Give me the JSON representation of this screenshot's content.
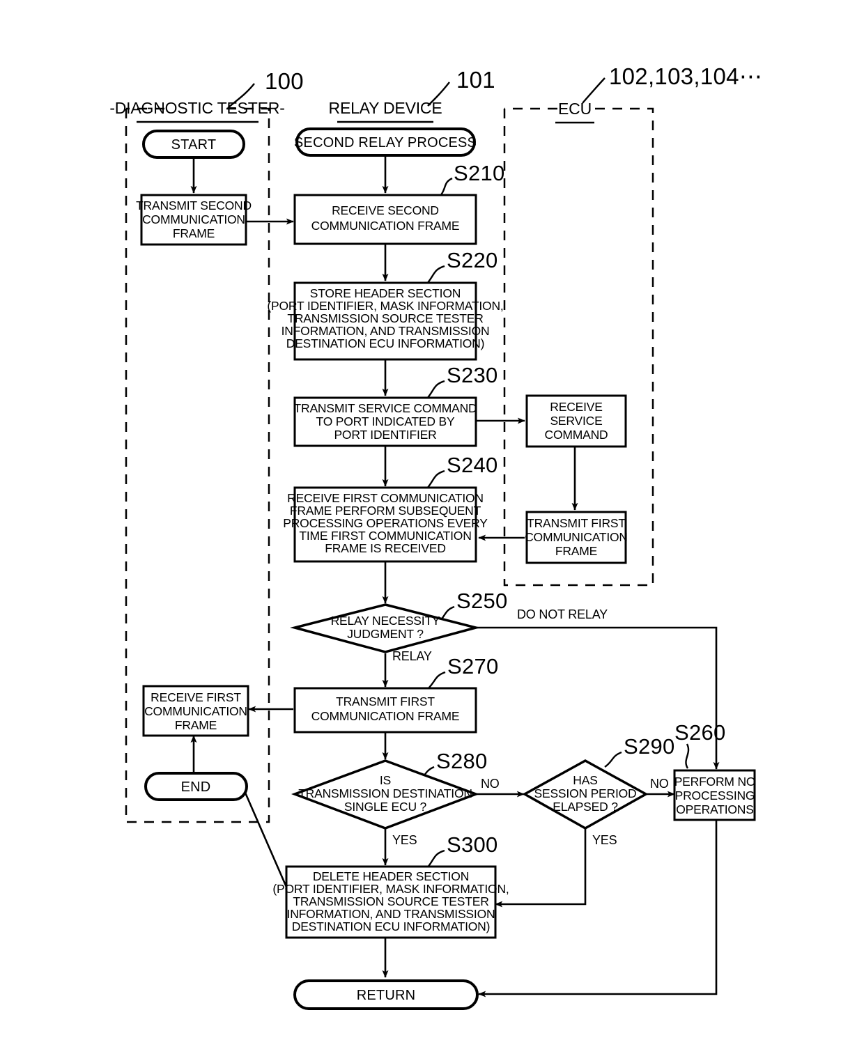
{
  "figure": {
    "type": "flowchart",
    "title": "Second relay process flowchart",
    "regions": [
      {
        "id": "tester",
        "label": "-DIAGNOSTIC TESTER-",
        "ref": "100",
        "style": "dashed"
      },
      {
        "id": "relay",
        "label": "RELAY DEVICE",
        "ref": "101",
        "style": "none"
      },
      {
        "id": "ecu",
        "label": "ECU",
        "ref": "102,103,104⋯",
        "style": "dashed"
      }
    ],
    "nodes": {
      "start": {
        "shape": "terminator",
        "text": "START",
        "region": "tester"
      },
      "transmit_second": {
        "shape": "process",
        "region": "tester",
        "lines": [
          "TRANSMIT SECOND",
          "COMMUNICATION",
          "FRAME"
        ]
      },
      "second_relay_process": {
        "shape": "terminator",
        "text": "SECOND RELAY PROCESS",
        "region": "relay"
      },
      "s210": {
        "shape": "process",
        "step": "S210",
        "region": "relay",
        "lines": [
          "RECEIVE SECOND",
          "COMMUNICATION FRAME"
        ]
      },
      "s220": {
        "shape": "process",
        "step": "S220",
        "region": "relay",
        "lines": [
          "STORE HEADER SECTION",
          "(PORT IDENTIFIER, MASK INFORMATION,",
          "TRANSMISSION SOURCE TESTER",
          "INFORMATION, AND TRANSMISSION",
          "DESTINATION ECU INFORMATION)"
        ]
      },
      "s230": {
        "shape": "process",
        "step": "S230",
        "region": "relay",
        "lines": [
          "TRANSMIT SERVICE COMMAND",
          "TO PORT INDICATED BY",
          "PORT IDENTIFIER"
        ]
      },
      "receive_service_command": {
        "shape": "process",
        "region": "ecu",
        "lines": [
          "RECEIVE",
          "SERVICE",
          "COMMAND"
        ]
      },
      "s240": {
        "shape": "process",
        "step": "S240",
        "region": "relay",
        "lines": [
          "RECEIVE FIRST COMMUNICATION",
          "FRAME PERFORM SUBSEQUENT",
          "PROCESSING OPERATIONS EVERY",
          "TIME FIRST COMMUNICATION",
          "FRAME IS RECEIVED"
        ]
      },
      "transmit_first_ecu": {
        "shape": "process",
        "region": "ecu",
        "lines": [
          "TRANSMIT FIRST",
          "COMMUNICATION",
          "FRAME"
        ]
      },
      "s250": {
        "shape": "decision",
        "step": "S250",
        "region": "relay",
        "lines": [
          "RELAY NECESSITY",
          "JUDGMENT ?"
        ],
        "branches": [
          "DO NOT RELAY",
          "RELAY"
        ]
      },
      "s270": {
        "shape": "process",
        "step": "S270",
        "region": "relay",
        "lines": [
          "TRANSMIT FIRST",
          "COMMUNICATION FRAME"
        ]
      },
      "receive_first_tester": {
        "shape": "process",
        "region": "tester",
        "lines": [
          "RECEIVE FIRST",
          "COMMUNICATION",
          "FRAME"
        ]
      },
      "end": {
        "shape": "terminator",
        "text": "END",
        "region": "tester"
      },
      "s280": {
        "shape": "decision",
        "step": "S280",
        "region": "relay",
        "lines": [
          "IS",
          "TRANSMISSION DESTINATION",
          "SINGLE ECU ?"
        ],
        "branches": [
          "NO",
          "YES"
        ]
      },
      "s290": {
        "shape": "decision",
        "step": "S290",
        "region": "relay",
        "lines": [
          "HAS",
          "SESSION PERIOD",
          "ELAPSED ?"
        ],
        "branches": [
          "NO",
          "YES"
        ]
      },
      "s260": {
        "shape": "process",
        "step": "S260",
        "region": "relay",
        "lines": [
          "PERFORM NO",
          "PROCESSING",
          "OPERATIONS"
        ]
      },
      "s300": {
        "shape": "process",
        "step": "S300",
        "region": "relay",
        "lines": [
          "DELETE HEADER SECTION",
          "(PORT IDENTIFIER, MASK INFORMATION,",
          "TRANSMISSION SOURCE TESTER",
          "INFORMATION, AND TRANSMISSION",
          "DESTINATION ECU INFORMATION)"
        ]
      },
      "return": {
        "shape": "terminator",
        "text": "RETURN",
        "region": "relay"
      }
    },
    "branch_labels": {
      "s250_right": "DO NOT RELAY",
      "s250_down": "RELAY",
      "s280_right": "NO",
      "s280_down": "YES",
      "s290_right": "NO",
      "s290_down": "YES"
    },
    "step_labels": {
      "s210": "S210",
      "s220": "S220",
      "s230": "S230",
      "s240": "S240",
      "s250": "S250",
      "s260": "S260",
      "s270": "S270",
      "s280": "S280",
      "s290": "S290",
      "s300": "S300"
    },
    "ref_labels": {
      "tester": "100",
      "relay": "101",
      "ecu": "102,103,104⋯"
    }
  }
}
